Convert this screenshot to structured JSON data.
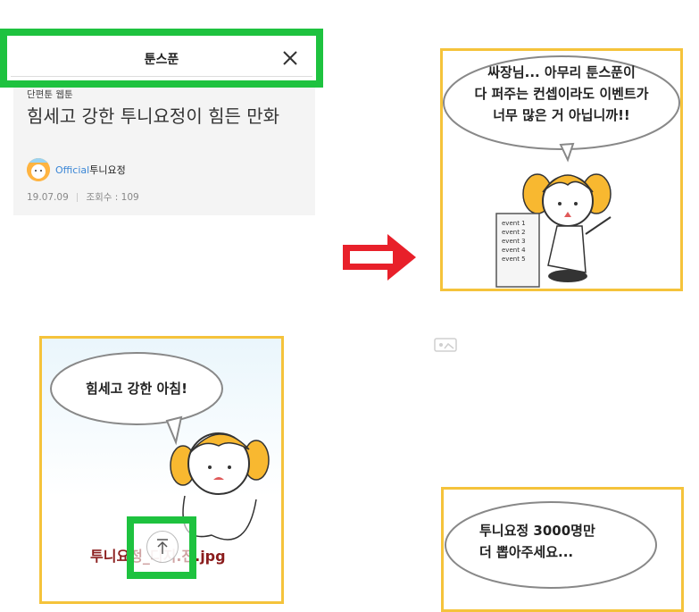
{
  "search": {
    "title": "툰스푼"
  },
  "post": {
    "genre": "단편툰 웹툰",
    "title": "힘세고 강한 투니요정이 힘든 만화",
    "official_label": "Official",
    "author": "투니요정",
    "date": "19.07.09",
    "views": "조회수 : 109"
  },
  "panels": {
    "panel1": {
      "bubble_lines": [
        "싸장님... 아무리 툰스푼이",
        "다 퍼주는 컨셉이라도 이벤트가",
        "너무 많은 거 아닙니까!!"
      ],
      "scroll_items": [
        "event 1",
        "event 2",
        "event 3",
        "event 4",
        "event 5"
      ]
    },
    "panel2": {
      "bubble_text": "힘세고 강한 아침!",
      "caption": "투니요정_디지.전.jpg"
    },
    "panel3": {
      "bubble_lines": [
        "투니요정 3000명만",
        "더 뽑아주세요..."
      ]
    }
  },
  "colors": {
    "highlight_green": "#1ec23f",
    "panel_border": "#f5c33b",
    "arrow_red": "#e8202a",
    "official_blue": "#3a86d6"
  },
  "icons": {
    "close": "close-icon",
    "arrow": "right-arrow-icon",
    "scroll_top": "scroll-to-top-icon"
  }
}
